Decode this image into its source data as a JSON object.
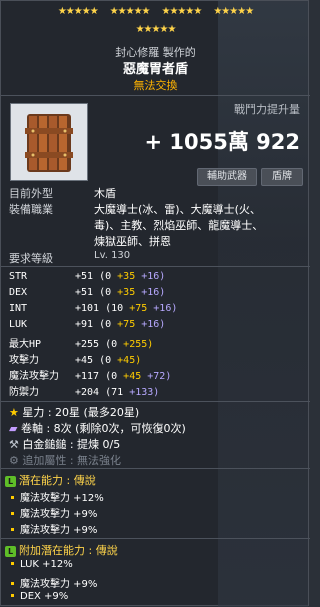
{
  "stars": {
    "row1": [
      "★★★★★",
      "★★★★★",
      "★★★★★",
      "★★★★★"
    ],
    "row2": "★★★★★"
  },
  "item": {
    "maker": "封心修羅 製作的",
    "name": "惡魔胃者盾",
    "trade": "無法交換",
    "power_label": "戰鬥力提升量",
    "power_value": "+ 1055萬 922",
    "btn1": "輔助武器",
    "btn2": "盾牌"
  },
  "info": {
    "appearance_label": "目前外型",
    "appearance_value": "木盾",
    "job_label": "裝備職業",
    "job_value": [
      "大魔導士(冰、雷)、大魔導士(火、",
      "毒)、主教、烈焰巫師、龍魔導士、",
      "煉獄巫師、拼恩"
    ],
    "req_label": "要求等級",
    "req_value": "Lv. 130"
  },
  "stats": [
    {
      "name": "STR",
      "base": "+51 (0 ",
      "a": "+35 ",
      "b": "+16)"
    },
    {
      "name": "DEX",
      "base": "+51 (0 ",
      "a": "+35 ",
      "b": "+16)"
    },
    {
      "name": "INT",
      "base": "+101 (10 ",
      "a": "+75 ",
      "b": "+16)"
    },
    {
      "name": "LUK",
      "base": "+91 (0 ",
      "a": "+75 ",
      "b": "+16)"
    },
    {
      "name": "最大HP",
      "base": "+255 (0 ",
      "a": "+255)",
      "b": ""
    },
    {
      "name": "攻擊力",
      "base": "+45 (0 ",
      "a": "+45)",
      "b": ""
    },
    {
      "name": "魔法攻擊力",
      "base": "+117 (0 ",
      "a": "+45 ",
      "b": "+72)"
    },
    {
      "name": "防禦力",
      "base": "+204 (71 ",
      "a": "",
      "b": "+133)"
    }
  ],
  "extra": [
    {
      "label": "星力 : 20星 (最多20星)"
    },
    {
      "label": "卷軸 : 8次 (剩除0次，可恢復0次)"
    },
    {
      "label": "白金鎚鎚 : 提煉 0/5"
    },
    {
      "label": "追加屬性 : 無法強化"
    }
  ],
  "potential": {
    "head": "潛在能力 : 傳說",
    "lines": [
      "魔法攻擊力 +12%",
      "魔法攻擊力 +9%",
      "魔法攻擊力 +9%"
    ]
  },
  "bonus": {
    "head": "附加潛在能力 : 傳說",
    "lines": [
      "LUK +12%",
      "魔法攻擊力 +9%",
      "DEX +9%"
    ]
  }
}
